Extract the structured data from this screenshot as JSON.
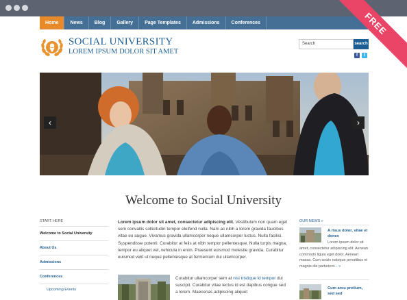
{
  "ribbon": "FREE",
  "nav": [
    "Home",
    "News",
    "Blog",
    "Gallery",
    "Page Templates",
    "Admissions",
    "Conferences"
  ],
  "site": {
    "title": "SOCIAL UNIVERSITY",
    "subtitle": "LOREM IPSUM DOLOR SIT AMET"
  },
  "search": {
    "placeholder": "Search",
    "button": "search"
  },
  "social": [
    "facebook-icon",
    "twitter-icon"
  ],
  "hero": {
    "prev": "‹",
    "next": "›"
  },
  "welcome": "Welcome to Social University",
  "sidebar": {
    "heading": "START HERE",
    "items": [
      "Welcome to Social University",
      "About Us",
      "Admissions",
      "Conferences"
    ],
    "sub": "Upcoming Events"
  },
  "content": {
    "lead_bold": "Lorem ipsum dolor sit amet, consectetur adipiscing elit.",
    "lead_rest": "Vestibulum non quam eget sem convallis sollicitudin tempor eleifend nulla. Nam ac nibh a lorem gravida faucibus vitae eu augue. Vivamus gravida ullamcorper neque ullamcorper luctus. Nulla facilisi. Suspendisse potenti. Curabitur at felis at nibh tempor pellentesque. Nulla turpis magna, tempor eu aliquet vel, vehicula in enim. Praesent euismod molestie gravida. Curabitur euismod velit ut neque pellentesque at fermentum dui ullamcorper.",
    "p2_a": "Curabitur ullamcorper sem at",
    "p2_link": "nisi tristique id tempor",
    "p2_b": "dui suscipit. Curabitur vitae lectus id est dapibus congue sed a lorem. Maecenas adipiscing aliquet"
  },
  "news": {
    "heading": "OUR NEWS »",
    "items": [
      {
        "title": "A risus dolor, vitae et donec",
        "line1": "Lorem ipsum dolor sit",
        "rest": "amet, consectetur adipiscing elit. Aenean commodo ligula eget dolor. Aenean massa. Cum sociis natoque penatibus et magnis dis parturient...",
        "more": "»"
      },
      {
        "title": "Cum arcu pretium, sed sed"
      }
    ]
  },
  "colors": {
    "nav": "#456f95",
    "active": "#e88a2a",
    "brand": "#1d5d92",
    "ribbon": "#ea4567"
  }
}
